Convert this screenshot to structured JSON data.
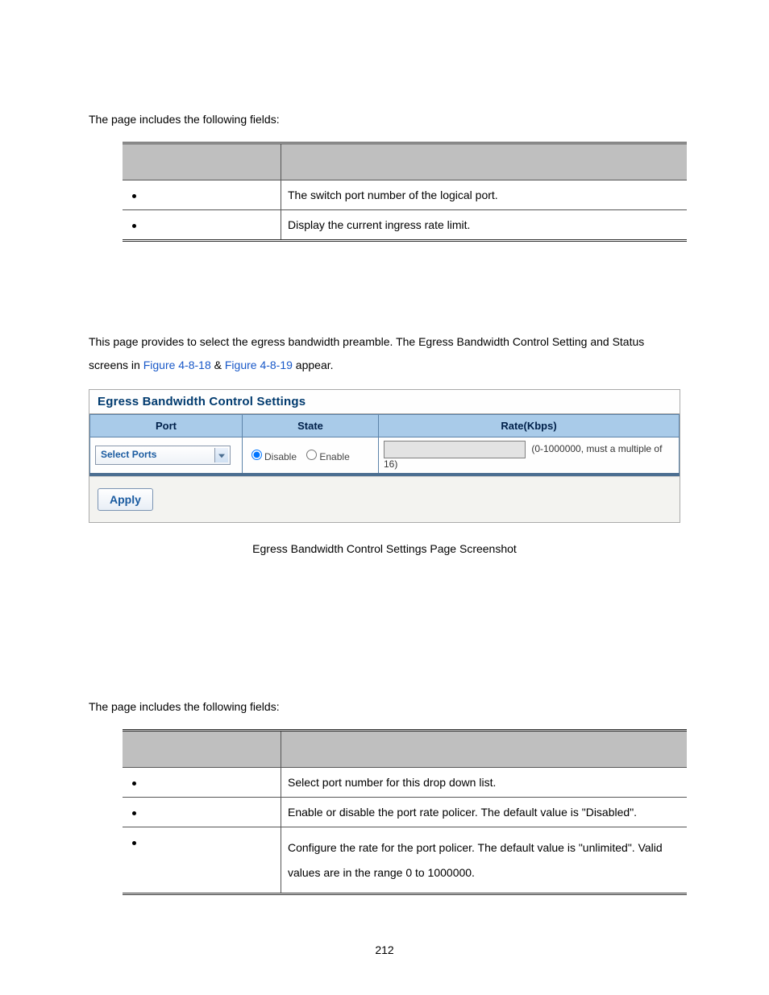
{
  "intro1": "The page includes the following fields:",
  "table1": {
    "rows": [
      {
        "desc": "The switch port number of the logical port."
      },
      {
        "desc": "Display the current ingress rate limit."
      }
    ]
  },
  "paragraph": {
    "pre": "This page provides to select the egress bandwidth preamble. The Egress Bandwidth Control Setting and Status screens in ",
    "link1": "Figure 4-8-18",
    "amp": " & ",
    "link2": "Figure 4-8-19",
    "post": " appear."
  },
  "panel": {
    "title": "Egress Bandwidth Control Settings",
    "headers": {
      "port": "Port",
      "state": "State",
      "rate": "Rate(Kbps)"
    },
    "select_label": "Select Ports",
    "radio_disable": "Disable",
    "radio_enable": "Enable",
    "rate_hint": "(0-1000000, must a multiple of 16)",
    "apply": "Apply"
  },
  "caption": "Egress Bandwidth Control Settings Page Screenshot",
  "intro2": "The page includes the following fields:",
  "table2": {
    "rows": [
      {
        "desc": "Select port number for this drop down list."
      },
      {
        "desc": "Enable or disable the port rate policer. The default value is \"Disabled\"."
      },
      {
        "desc": "Configure the rate for the port policer. The default value is \"unlimited\". Valid values are in the range 0 to 1000000."
      }
    ]
  },
  "page_number": "212"
}
